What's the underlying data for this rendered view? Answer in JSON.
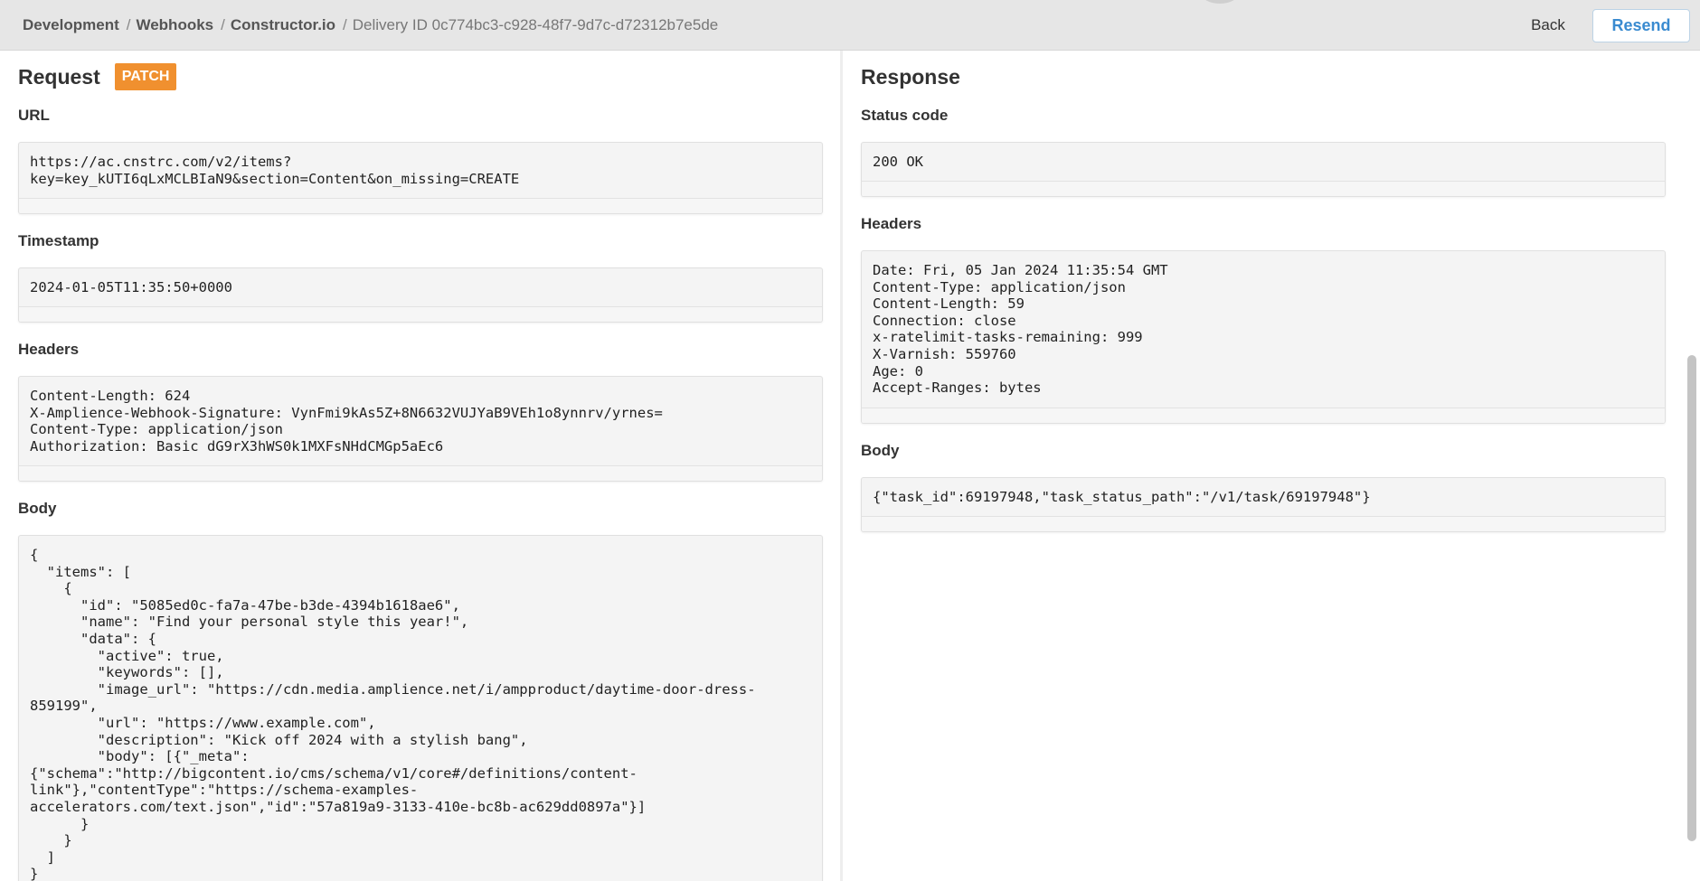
{
  "breadcrumb": {
    "items": [
      "Development",
      "Webhooks",
      "Constructor.io"
    ],
    "current": "Delivery ID 0c774bc3-c928-48f7-9d7c-d72312b7e5de",
    "separator": "/"
  },
  "actions": {
    "back_label": "Back",
    "resend_label": "Resend"
  },
  "request": {
    "title": "Request",
    "method": "PATCH",
    "url_label": "URL",
    "url": "https://ac.cnstrc.com/v2/items?\nkey=key_kUTI6qLxMCLBIaN9&section=Content&on_missing=CREATE",
    "timestamp_label": "Timestamp",
    "timestamp": "2024-01-05T11:35:50+0000",
    "headers_label": "Headers",
    "headers": "Content-Length: 624\nX-Amplience-Webhook-Signature: VynFmi9kAs5Z+8N6632VUJYaB9VEh1o8ynnrv/yrnes=\nContent-Type: application/json\nAuthorization: Basic dG9rX3hWS0k1MXFsNHdCMGp5aEc6",
    "body_label": "Body",
    "body": "{\n  \"items\": [\n    {\n      \"id\": \"5085ed0c-fa7a-47be-b3de-4394b1618ae6\",\n      \"name\": \"Find your personal style this year!\",\n      \"data\": {\n        \"active\": true,\n        \"keywords\": [],\n        \"image_url\": \"https://cdn.media.amplience.net/i/ampproduct/daytime-door-dress-\n859199\",\n        \"url\": \"https://www.example.com\",\n        \"description\": \"Kick off 2024 with a stylish bang\",\n        \"body\": [{\"_meta\":\n{\"schema\":\"http://bigcontent.io/cms/schema/v1/core#/definitions/content-\nlink\"},\"contentType\":\"https://schema-examples-\naccelerators.com/text.json\",\"id\":\"57a819a9-3133-410e-bc8b-ac629dd0897a\"}]\n      }\n    }\n  ]\n}"
  },
  "response": {
    "title": "Response",
    "status_label": "Status code",
    "status": "200 OK",
    "headers_label": "Headers",
    "headers": "Date: Fri, 05 Jan 2024 11:35:54 GMT\nContent-Type: application/json\nContent-Length: 59\nConnection: close\nx-ratelimit-tasks-remaining: 999\nX-Varnish: 559760\nAge: 0\nAccept-Ranges: bytes",
    "body_label": "Body",
    "body": "{\"task_id\":69197948,\"task_status_path\":\"/v1/task/69197948\"}"
  }
}
